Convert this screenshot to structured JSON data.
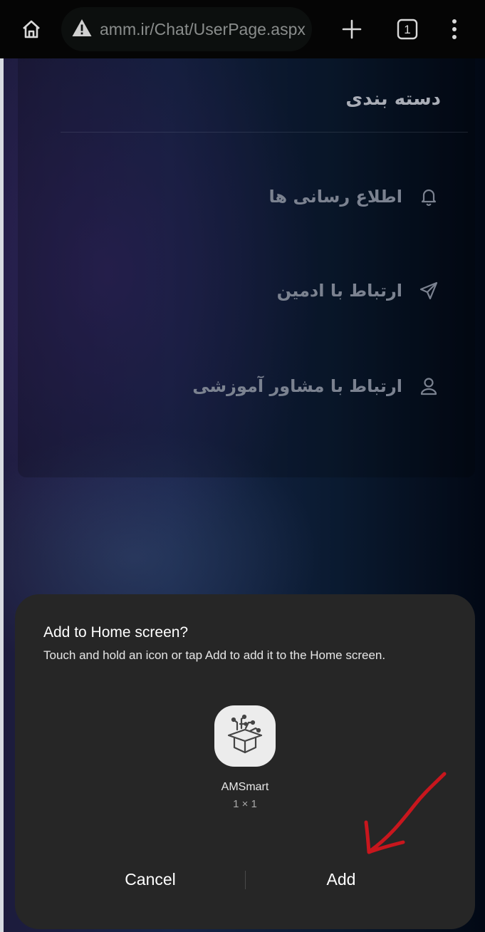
{
  "browser": {
    "url": "amm.ir/Chat/UserPage.aspx",
    "tab_count": "1",
    "icons": {
      "home": "home-icon",
      "warning": "warning-icon",
      "new_tab": "plus-icon",
      "tabs": "tabs-icon",
      "menu": "more-vert-icon"
    }
  },
  "menu": {
    "title": "دسته بندی",
    "items": [
      {
        "label": "اطلاع رسانی ها",
        "icon": "bell-icon"
      },
      {
        "label": "ارتباط با ادمین",
        "icon": "send-icon"
      },
      {
        "label": "ارتباط با مشاور آموزشی",
        "icon": "user-icon"
      }
    ]
  },
  "dialog": {
    "title": "Add to Home screen?",
    "description": "Touch and hold an icon or tap Add to add it to the Home screen.",
    "app_name": "AMSmart",
    "widget_size": "1 × 1",
    "cancel_label": "Cancel",
    "add_label": "Add",
    "colors": {
      "background": "#262626",
      "annotation_arrow": "#c8161d"
    }
  }
}
